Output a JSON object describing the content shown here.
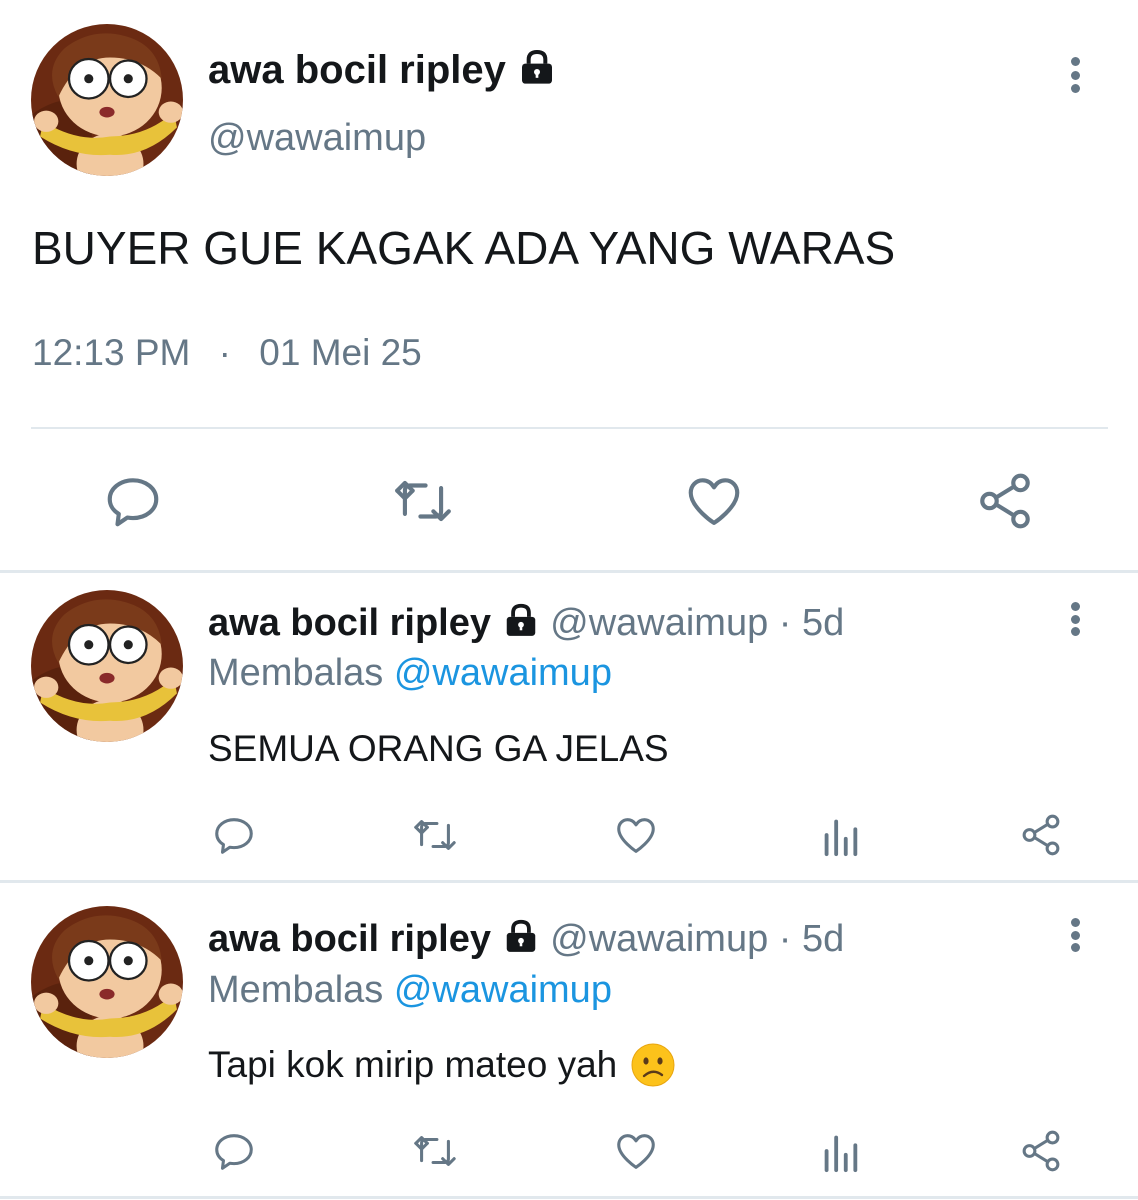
{
  "main_tweet": {
    "display_name": "awa bocil ripley",
    "handle": "@wawaimup",
    "text": "BUYER GUE KAGAK ADA YANG WARAS",
    "time": "12:13 PM",
    "separator": "·",
    "date": "01 Mei 25",
    "actions": [
      "reply-icon",
      "retweet-icon",
      "like-icon",
      "share-icon"
    ]
  },
  "replies": [
    {
      "display_name": "awa bocil ripley",
      "handle": "@wawaimup",
      "age": "· 5d",
      "reply_prefix": "Membalas",
      "reply_to": "@wawaimup",
      "text": "SEMUA ORANG GA JELAS",
      "actions": [
        "reply-icon",
        "retweet-icon",
        "like-icon",
        "analytics-icon",
        "share-icon"
      ]
    },
    {
      "display_name": "awa bocil ripley",
      "handle": "@wawaimup",
      "age": "· 5d",
      "reply_prefix": "Membalas",
      "reply_to": "@wawaimup",
      "text": "Tapi kok mirip mateo yah",
      "emoji": "slightly-frowning-face",
      "actions": [
        "reply-icon",
        "retweet-icon",
        "like-icon",
        "analytics-icon",
        "share-icon"
      ]
    }
  ],
  "colors": {
    "text": "#14171a",
    "secondary": "#657786",
    "link": "#1b95e0",
    "divider": "#e1e8ed",
    "avatar_bg": "#6b2a12"
  }
}
